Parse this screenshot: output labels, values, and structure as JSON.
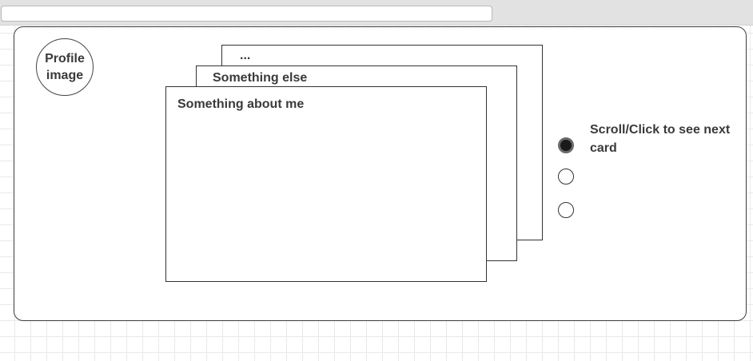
{
  "profile": {
    "label": "Profile image"
  },
  "cards": [
    {
      "title": "Something about me"
    },
    {
      "title": "Something else"
    },
    {
      "title": "..."
    }
  ],
  "pager": {
    "active_index": 0,
    "count": 3
  },
  "hint": {
    "text": "Scroll/Click to see next card"
  }
}
